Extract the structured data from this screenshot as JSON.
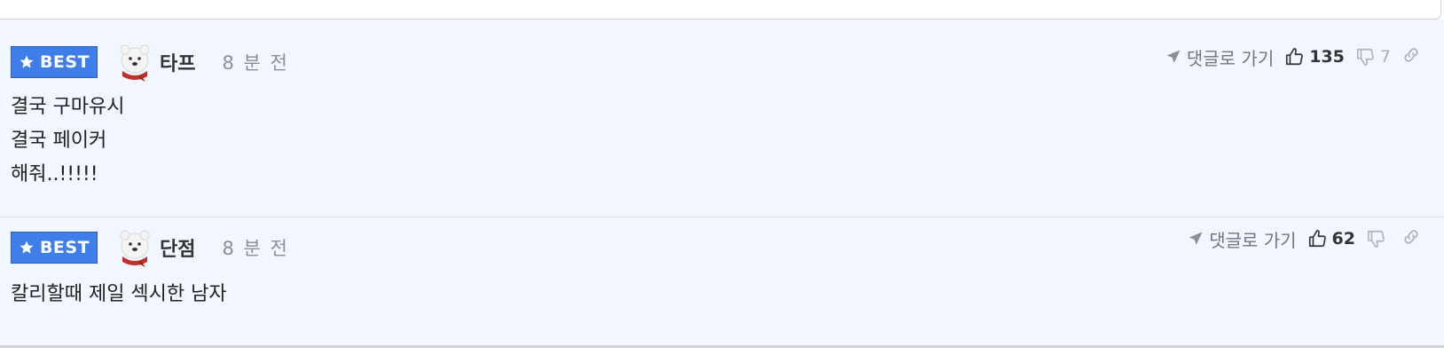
{
  "comments": [
    {
      "badge": "BEST",
      "nickname": "타프",
      "time": "8 분 전",
      "goto_label": "댓글로 가기",
      "upvotes": "135",
      "downvotes": "7",
      "lines": [
        "결국 구마유시",
        "결국 페이커",
        "해줘..!!!!!"
      ]
    },
    {
      "badge": "BEST",
      "nickname": "단점",
      "time": "8 분 전",
      "goto_label": "댓글로 가기",
      "upvotes": "62",
      "downvotes": "",
      "lines": [
        "칼리할때 제일 섹시한 남자"
      ]
    }
  ],
  "colors": {
    "badge": "#3f7ee8",
    "comment_bg": "#f1f6ff",
    "muted": "#8a8f99"
  },
  "icons": [
    "star-icon",
    "polar-bear-avatar-icon",
    "send-arrow-icon",
    "thumbs-up-icon",
    "thumbs-down-icon",
    "link-icon"
  ]
}
